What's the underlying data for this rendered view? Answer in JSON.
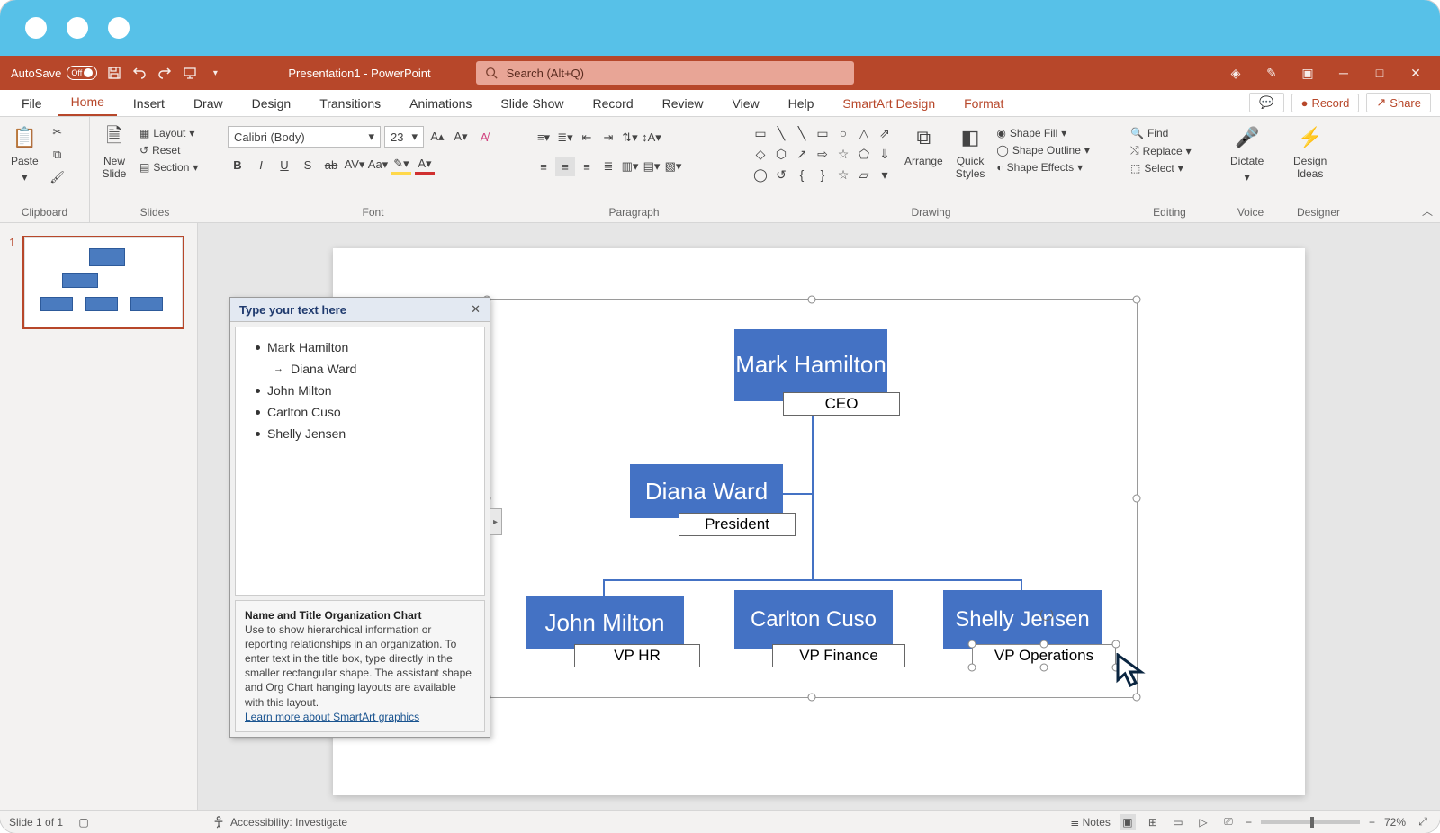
{
  "titlebar": {
    "autosave_label": "AutoSave",
    "autosave_state": "Off",
    "doc_title": "Presentation1 - PowerPoint",
    "search_placeholder": "Search (Alt+Q)"
  },
  "tabs": {
    "file": "File",
    "home": "Home",
    "insert": "Insert",
    "draw": "Draw",
    "design": "Design",
    "transitions": "Transitions",
    "animations": "Animations",
    "slideshow": "Slide Show",
    "record": "Record",
    "review": "Review",
    "view": "View",
    "help": "Help",
    "smartart": "SmartArt Design",
    "format": "Format",
    "btn_record": "Record",
    "btn_share": "Share"
  },
  "ribbon": {
    "clipboard": {
      "label": "Clipboard",
      "paste": "Paste"
    },
    "slides": {
      "label": "Slides",
      "new_slide": "New\nSlide",
      "layout": "Layout",
      "reset": "Reset",
      "section": "Section"
    },
    "font": {
      "label": "Font",
      "name": "Calibri (Body)",
      "size": "23"
    },
    "paragraph": {
      "label": "Paragraph"
    },
    "drawing": {
      "label": "Drawing",
      "arrange": "Arrange",
      "quick_styles": "Quick\nStyles",
      "shape_fill": "Shape Fill",
      "shape_outline": "Shape Outline",
      "shape_effects": "Shape Effects"
    },
    "editing": {
      "label": "Editing",
      "find": "Find",
      "replace": "Replace",
      "select": "Select"
    },
    "voice": {
      "label": "Voice",
      "dictate": "Dictate"
    },
    "designer": {
      "label": "Designer",
      "design_ideas": "Design\nIdeas"
    }
  },
  "thumbnails": {
    "slide1": "1"
  },
  "text_pane": {
    "header": "Type your text here",
    "items": [
      "Mark Hamilton",
      "Diana Ward",
      "John Milton",
      "Carlton Cuso",
      "Shelly Jensen"
    ],
    "desc_title": "Name and Title Organization Chart",
    "desc_body": "Use to show hierarchical information or reporting relationships in an organization. To enter text in the title box, type directly in the smaller rectangular shape. The assistant shape and Org Chart hanging layouts are available with this layout.",
    "desc_link": "Learn more about SmartArt graphics"
  },
  "org": {
    "n1": {
      "name": "Mark Hamilton",
      "title": "CEO"
    },
    "n2": {
      "name": "Diana Ward",
      "title": "President"
    },
    "n3": {
      "name": "John Milton",
      "title": "VP HR"
    },
    "n4": {
      "name": "Carlton Cuso",
      "title": "VP Finance"
    },
    "n5": {
      "name": "Shelly Jensen",
      "title": "VP Operations"
    }
  },
  "statusbar": {
    "slide_info": "Slide 1 of 1",
    "accessibility": "Accessibility: Investigate",
    "notes": "Notes",
    "zoom": "72%"
  }
}
